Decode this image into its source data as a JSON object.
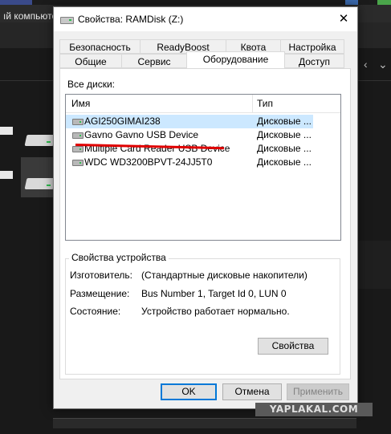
{
  "background": {
    "window_title": "ıй компьюте",
    "nav_controls": [
      "‹",
      "⌄"
    ]
  },
  "dialog": {
    "title": "Свойства: RAMDisk (Z:)",
    "close_glyph": "✕",
    "tabs_row1": [
      "Безопасность",
      "ReadyBoost",
      "Квота",
      "Настройка"
    ],
    "tabs_row2": [
      "Общие",
      "Сервис",
      "Оборудование",
      "Доступ"
    ],
    "active_tab": "Оборудование",
    "all_disks_label": "Все диски:",
    "list": {
      "columns": [
        "Имя",
        "Тип"
      ],
      "rows": [
        {
          "name": "AGI250GIMAI238",
          "type": "Дисковые ...",
          "selected": true
        },
        {
          "name": "Gavno Gavno USB Device",
          "type": "Дисковые ...",
          "selected": false
        },
        {
          "name": "Multiple Card  Reader USB Device",
          "type": "Дисковые ...",
          "selected": false
        },
        {
          "name": "WDC WD3200BPVT-24JJ5T0",
          "type": "Дисковые ...",
          "selected": false
        }
      ]
    },
    "device_properties": {
      "title": "Свойства устройства",
      "manufacturer_label": "Изготовитель:",
      "manufacturer_value": "(Стандартные дисковые накопители)",
      "location_label": "Размещение:",
      "location_value": "Bus Number 1, Target Id 0, LUN 0",
      "status_label": "Состояние:",
      "status_value": "Устройство работает нормально.",
      "properties_button": "Свойства"
    },
    "buttons": {
      "ok": "OK",
      "cancel": "Отмена",
      "apply": "Применить"
    }
  },
  "watermark": "YAPLAKAL.COM",
  "colors": {
    "selection": "#cce8ff",
    "annotation_underline": "#e00000",
    "default_button_border": "#0078d7"
  }
}
